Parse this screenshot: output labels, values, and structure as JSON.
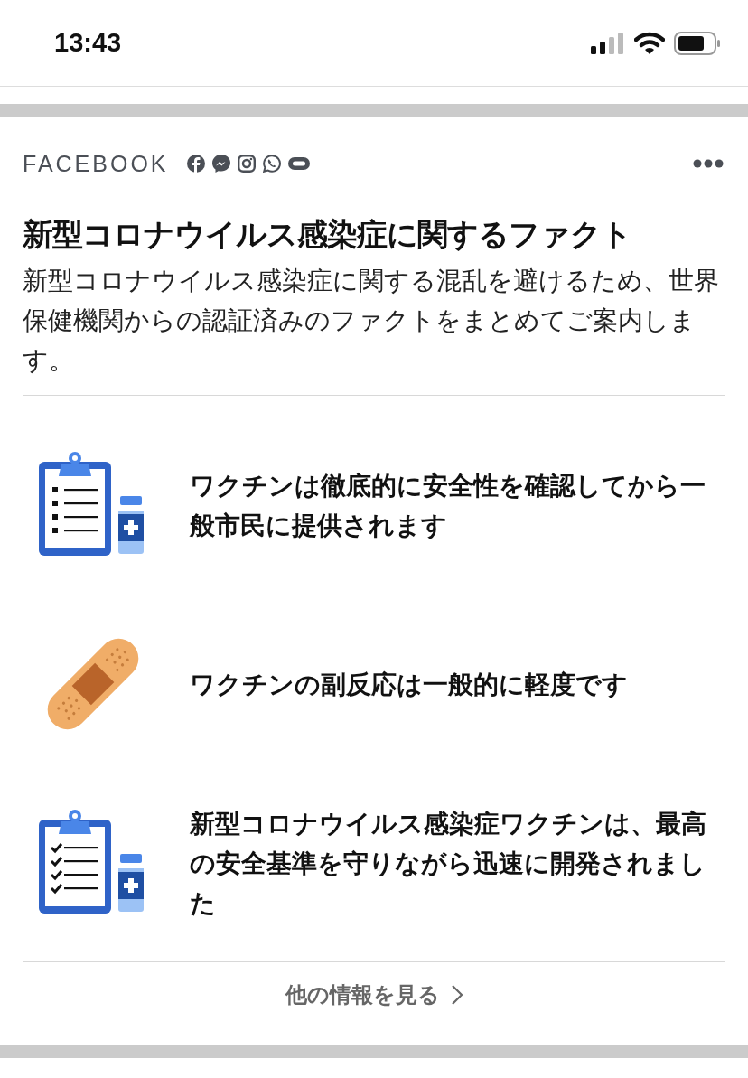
{
  "status_bar": {
    "time": "13:43"
  },
  "card": {
    "brand": "FACEBOOK",
    "title": "新型コロナウイルス感染症に関するファクト",
    "description": "新型コロナウイルス感染症に関する混乱を避けるため、世界保健機関からの認証済みのファクトをまとめてご案内します。",
    "facts": [
      {
        "kind": "checklist-vial",
        "text": "ワクチンは徹底的に安全性を確認してから一般市民に提供されます"
      },
      {
        "kind": "bandage",
        "text": "ワクチンの副反応は一般的に軽度です"
      },
      {
        "kind": "checkmarks-vial",
        "text": "新型コロナウイルス感染症ワクチンは、最高の安全基準を守りながら迅速に開発されました"
      }
    ],
    "more_link": "他の情報を見る"
  }
}
